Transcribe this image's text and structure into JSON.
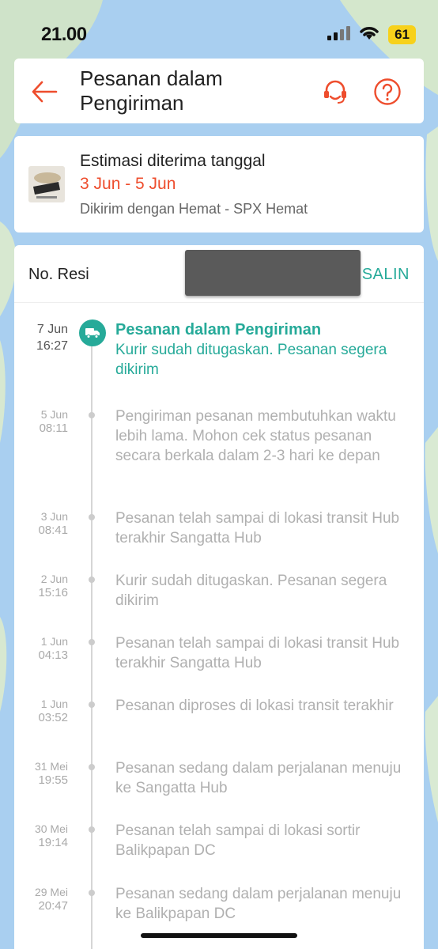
{
  "status_bar": {
    "time": "21.00",
    "battery": "61"
  },
  "header": {
    "title": "Pesanan dalam Pengiriman"
  },
  "estimate": {
    "label": "Estimasi diterima tanggal",
    "date_range": "3 Jun - 5 Jun",
    "courier": "Dikirim dengan Hemat - SPX Hemat"
  },
  "tracking": {
    "resi_label": "No. Resi",
    "copy_label": "SALIN",
    "current": {
      "date": "7 Jun",
      "time": "16:27",
      "title": "Pesanan dalam Pengiriman",
      "description": "Kurir sudah ditugaskan. Pesanan segera dikirim"
    },
    "events": [
      {
        "date": "5 Jun",
        "time": "08:11",
        "text": "Pengiriman pesanan membutuhkan waktu lebih lama. Mohon cek status pesanan secara berkala dalam 2-3 hari ke depan"
      },
      {
        "date": "3 Jun",
        "time": "08:41",
        "text": "Pesanan telah sampai di lokasi transit Hub terakhir Sangatta Hub"
      },
      {
        "date": "2 Jun",
        "time": "15:16",
        "text": "Kurir sudah ditugaskan. Pesanan segera dikirim"
      },
      {
        "date": "1 Jun",
        "time": "04:13",
        "text": "Pesanan telah sampai di lokasi transit Hub terakhir Sangatta Hub"
      },
      {
        "date": "1 Jun",
        "time": "03:52",
        "text": "Pesanan diproses di lokasi transit terakhir"
      },
      {
        "date": "31 Mei",
        "time": "19:55",
        "text": "Pesanan sedang dalam perjalanan menuju ke Sangatta Hub"
      },
      {
        "date": "30 Mei",
        "time": "19:14",
        "text": "Pesanan telah sampai di lokasi sortir Balikpapan DC"
      },
      {
        "date": "29 Mei",
        "time": "20:47",
        "text": "Pesanan sedang dalam perjalanan menuju ke Balikpapan DC"
      }
    ]
  },
  "colors": {
    "accent": "#ee4d2d",
    "teal": "#26aa99",
    "inactive_text": "#b0b0b0"
  },
  "icons": [
    "back-arrow-icon",
    "headset-icon",
    "help-icon",
    "truck-icon",
    "signal-icon",
    "wifi-icon"
  ]
}
